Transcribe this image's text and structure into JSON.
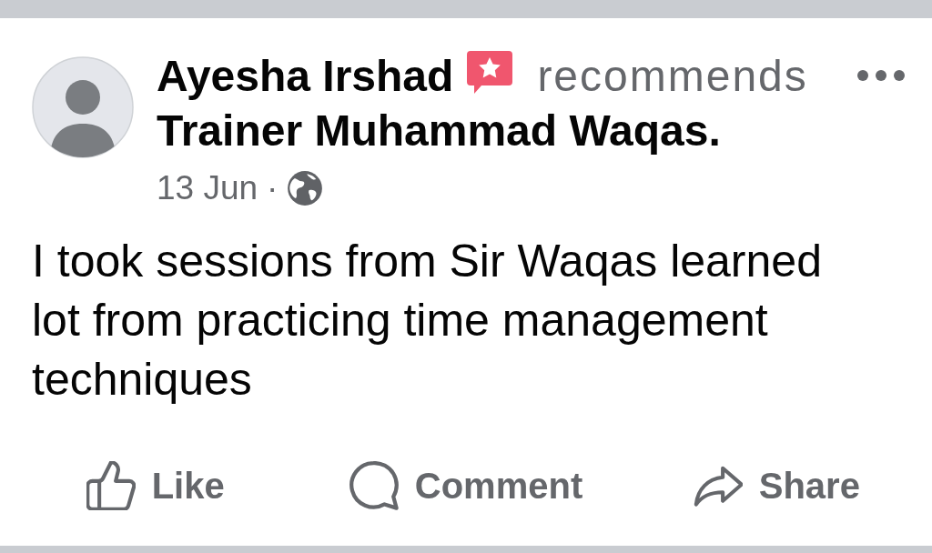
{
  "post": {
    "author": "Ayesha Irshad",
    "action": "recommends",
    "page": "Trainer Muhammad Waqas.",
    "date": "13 Jun",
    "separator": "·",
    "text": "I took sessions from Sir Waqas learned lot from practicing time management techniques"
  },
  "actions": [
    {
      "kind": "like",
      "label": "Like"
    },
    {
      "kind": "comment",
      "label": "Comment"
    },
    {
      "kind": "share",
      "label": "Share"
    }
  ]
}
